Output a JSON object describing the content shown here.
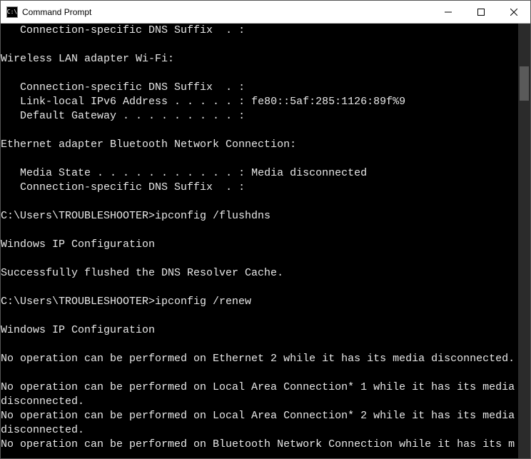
{
  "window": {
    "title": "Command Prompt",
    "icon_label": "cmd-icon"
  },
  "console": {
    "lines": [
      "   Connection-specific DNS Suffix  . :",
      "",
      "Wireless LAN adapter Wi-Fi:",
      "",
      "   Connection-specific DNS Suffix  . :",
      "   Link-local IPv6 Address . . . . . : fe80::5af:285:1126:89f%9",
      "   Default Gateway . . . . . . . . . :",
      "",
      "Ethernet adapter Bluetooth Network Connection:",
      "",
      "   Media State . . . . . . . . . . . : Media disconnected",
      "   Connection-specific DNS Suffix  . :",
      "",
      "C:\\Users\\TROUBLESHOOTER>ipconfig /flushdns",
      "",
      "Windows IP Configuration",
      "",
      "Successfully flushed the DNS Resolver Cache.",
      "",
      "C:\\Users\\TROUBLESHOOTER>ipconfig /renew",
      "",
      "Windows IP Configuration",
      "",
      "No operation can be performed on Ethernet 2 while it has its media disconnected.",
      "",
      "No operation can be performed on Local Area Connection* 1 while it has its media disconnected.",
      "No operation can be performed on Local Area Connection* 2 while it has its media disconnected.",
      "No operation can be performed on Bluetooth Network Connection while it has its m"
    ]
  }
}
